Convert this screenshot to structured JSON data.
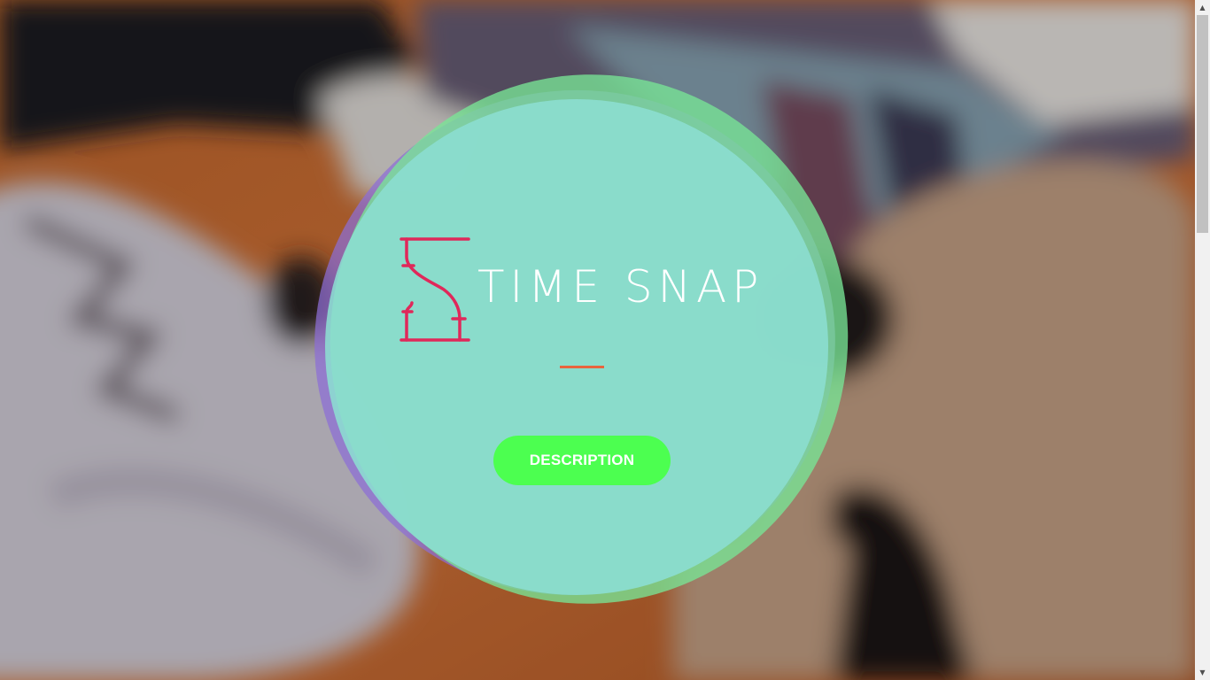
{
  "brand": {
    "name": "TIME SNAP",
    "logo_icon": "hourglass-icon",
    "logo_color": "#e0285a"
  },
  "hero": {
    "cta_label": "DESCRIPTION",
    "accent_divider_color": "#e8643e",
    "cta_color": "#4cff50"
  },
  "scrollbar": {
    "up_arrow": "▲",
    "down_arrow": "▼"
  }
}
